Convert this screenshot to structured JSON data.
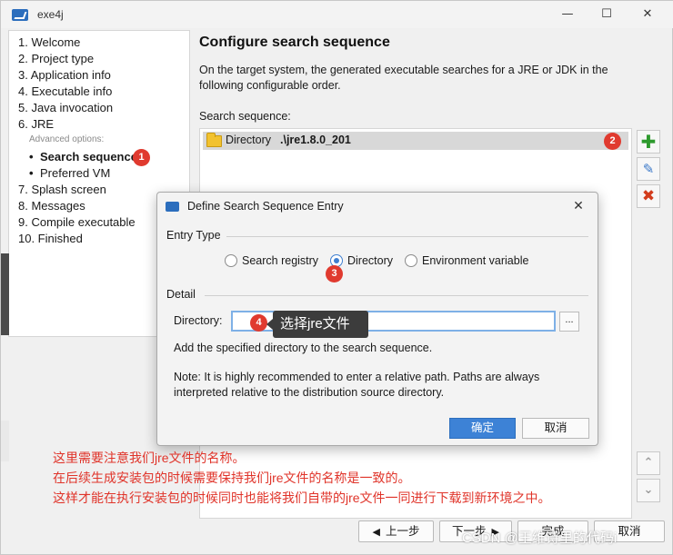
{
  "window": {
    "title": "exe4j",
    "minimize_glyph": "—",
    "maximize_glyph": "☐",
    "close_glyph": "✕"
  },
  "sidebar": {
    "steps": [
      "1. Welcome",
      "2. Project type",
      "3. Application info",
      "4. Executable info",
      "5. Java invocation",
      "6. JRE"
    ],
    "advanced_options_label": "Advanced options:",
    "sub_items": [
      "Search sequence",
      "Preferred VM"
    ],
    "bullet": "•",
    "steps_after": [
      "7. Splash screen",
      "8. Messages",
      "9. Compile executable",
      "10. Finished"
    ]
  },
  "main": {
    "title": "Configure search sequence",
    "description": "On the target system, the generated executable searches for a JRE or JDK in the following configurable order.",
    "search_sequence_label": "Search sequence:",
    "entries": [
      {
        "type": "Directory",
        "path": ".\\jre1.8.0_201"
      }
    ],
    "side_buttons": {
      "add": "✚",
      "edit": "✎",
      "remove": "✖",
      "up": "⌃",
      "down": "⌄"
    }
  },
  "nav": {
    "prev_arrow": "◀",
    "prev": "上一步",
    "next": "下一步",
    "next_arrow": "▶",
    "finish": "完成",
    "cancel": "取消"
  },
  "dialog": {
    "title": "Define Search Sequence Entry",
    "close_glyph": "✕",
    "entry_type_label": "Entry Type",
    "radios": [
      {
        "label": "Search registry",
        "checked": false
      },
      {
        "label": "Directory",
        "checked": true
      },
      {
        "label": "Environment variable",
        "checked": false
      }
    ],
    "detail_label": "Detail",
    "directory_label": "Directory:",
    "directory_value": "",
    "browse_label": "...",
    "help_text": "Add the specified directory to the search sequence.",
    "note_line1": "Note: It is highly recommended to enter a relative path. Paths are always",
    "note_line2": "interpreted relative to the distribution source directory.",
    "ok": "确定",
    "cancel": "取消"
  },
  "annotations": {
    "badges": [
      "1",
      "2",
      "3",
      "4"
    ],
    "tooltip": "选择jre文件",
    "notes": [
      "这里需要注意我们jre文件的名称。",
      "在后续生成安装包的时候需要保持我们jre文件的名称是一致的。",
      "这样才能在执行安装包的时候同时也能将我们自带的jre文件一同进行下载到新环境之中。"
    ],
    "colors": {
      "badge": "#e03a2f",
      "note": "#e0342a",
      "accent": "#3d82d6"
    },
    "watermark": "CSDN @王维诗里的代码i"
  }
}
